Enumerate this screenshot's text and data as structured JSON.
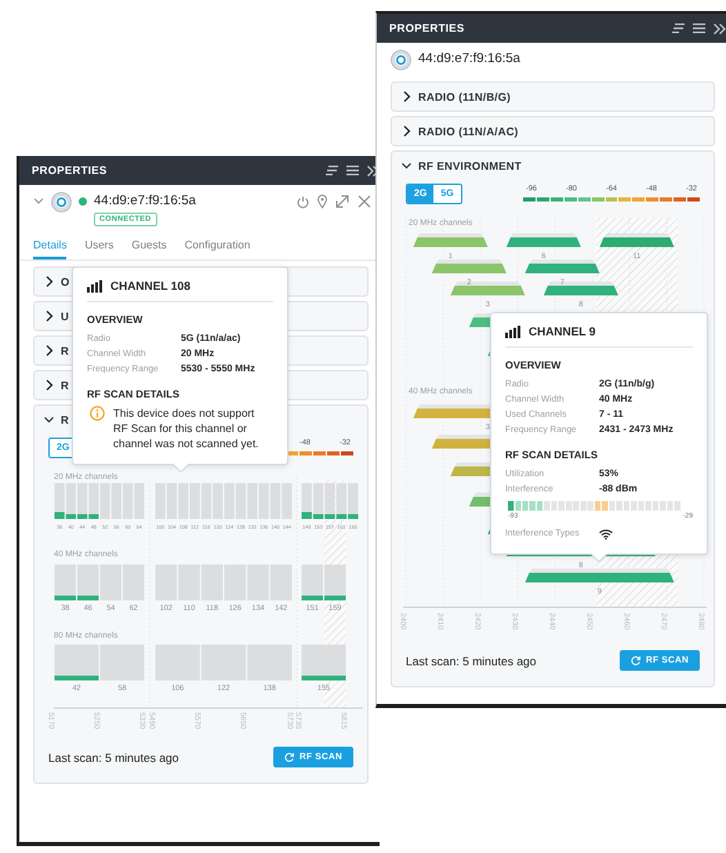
{
  "left_panel": {
    "header": {
      "title": "PROPERTIES"
    },
    "device": {
      "expanded": true,
      "online": true,
      "mac": "44:d9:e7:f9:16:5a",
      "status": "CONNECTED"
    },
    "tabs": [
      {
        "label": "Details",
        "selected": true
      },
      {
        "label": "Users",
        "selected": false
      },
      {
        "label": "Guests",
        "selected": false
      },
      {
        "label": "Configuration",
        "selected": false
      }
    ],
    "sections": [
      {
        "label": "O",
        "expanded": false
      },
      {
        "label": "U",
        "expanded": false
      },
      {
        "label": "R",
        "expanded": false
      },
      {
        "label": "R",
        "expanded": false
      },
      {
        "label": "R",
        "expanded": true
      }
    ],
    "rf": {
      "bands": [
        {
          "label": "2G",
          "selected": false
        }
      ],
      "scale": [
        "-48",
        "-32"
      ],
      "chart": {
        "kind": "grid",
        "rows": [
          {
            "label": "20 MHz channels",
            "groups": [
              [
                {
                  "label": "36",
                  "active": true
                },
                {
                  "label": "40",
                  "active": true
                },
                {
                  "label": "44",
                  "active": true
                },
                {
                  "label": "48",
                  "active": true
                },
                {
                  "label": "52",
                  "active": false
                },
                {
                  "label": "56",
                  "active": false
                },
                {
                  "label": "60",
                  "active": false
                },
                {
                  "label": "64",
                  "active": false
                }
              ],
              [
                {
                  "label": "100",
                  "active": false
                },
                {
                  "label": "104",
                  "active": false
                },
                {
                  "label": "108",
                  "active": false
                },
                {
                  "label": "112",
                  "active": false
                },
                {
                  "label": "116",
                  "active": false
                },
                {
                  "label": "120",
                  "active": false
                },
                {
                  "label": "124",
                  "active": false
                },
                {
                  "label": "128",
                  "active": false
                },
                {
                  "label": "132",
                  "active": false
                },
                {
                  "label": "136",
                  "active": false
                },
                {
                  "label": "140",
                  "active": false
                },
                {
                  "label": "144",
                  "active": false
                }
              ],
              [
                {
                  "label": "149",
                  "active": true
                },
                {
                  "label": "153",
                  "active": true
                },
                {
                  "label": "157",
                  "active": true
                },
                {
                  "label": "161",
                  "active": true
                },
                {
                  "label": "165",
                  "active": true
                }
              ]
            ]
          },
          {
            "label": "40 MHz channels",
            "groups": [
              [
                {
                  "label": "38",
                  "active": true
                },
                {
                  "label": "46",
                  "active": true
                },
                {
                  "label": "54",
                  "active": false
                },
                {
                  "label": "62",
                  "active": false
                }
              ],
              [
                {
                  "label": "102",
                  "active": false
                },
                {
                  "label": "110",
                  "active": false
                },
                {
                  "label": "118",
                  "active": false
                },
                {
                  "label": "126",
                  "active": false
                },
                {
                  "label": "134",
                  "active": false
                },
                {
                  "label": "142",
                  "active": false
                }
              ],
              [
                {
                  "label": "151",
                  "active": true
                },
                {
                  "label": "159",
                  "active": true
                }
              ]
            ]
          },
          {
            "label": "80 MHz channels",
            "groups": [
              [
                {
                  "label": "42",
                  "active": true
                },
                {
                  "label": "58",
                  "active": false
                }
              ],
              [
                {
                  "label": "106",
                  "active": false
                },
                {
                  "label": "122",
                  "active": false
                },
                {
                  "label": "138",
                  "active": false
                }
              ],
              [
                {
                  "label": "155",
                  "active": true
                }
              ]
            ]
          }
        ],
        "freq_labels": [
          "5170",
          "5250",
          "5330",
          "5490",
          "5570",
          "5650",
          "5730",
          "5735",
          "5815"
        ]
      },
      "last_scan": "Last scan: 5 minutes ago",
      "scan_button": "RF SCAN"
    },
    "tooltip": {
      "title": "CHANNEL 108",
      "blocks": [
        {
          "title": "OVERVIEW",
          "items": [
            {
              "kind": "row",
              "label": "Radio",
              "value": "5G (11n/a/ac)"
            },
            {
              "kind": "row",
              "label": "Channel Width",
              "value": "20 MHz"
            },
            {
              "kind": "row",
              "label": "Frequency Range",
              "value": "5530 - 5550 MHz"
            }
          ]
        },
        {
          "title": "RF SCAN DETAILS",
          "items": [
            {
              "kind": "notice",
              "text": "This device does not support RF Scan for this channel or channel was not scanned yet."
            }
          ]
        }
      ]
    }
  },
  "right_panel": {
    "header": {
      "title": "PROPERTIES"
    },
    "device": {
      "mac": "44:d9:e7:f9:16:5a"
    },
    "sections": [
      {
        "label": "RADIO (11N/B/G)",
        "expanded": false
      },
      {
        "label": "RADIO (11N/A/AC)",
        "expanded": false
      },
      {
        "label": "RF ENVIRONMENT",
        "expanded": true
      }
    ],
    "rf": {
      "bands": [
        {
          "label": "2G",
          "selected": true
        },
        {
          "label": "5G",
          "selected": false
        }
      ],
      "scale": [
        "-96",
        "-80",
        "-64",
        "-48",
        "-32"
      ],
      "chart": {
        "kind": "spectrum",
        "rows": [
          {
            "label": "20 MHz channels",
            "channel_labels": [
              "1",
              "6",
              "11",
              "2",
              "7",
              "3",
              "8"
            ]
          },
          {
            "label": "40 MHz channels",
            "channel_labels": [
              "3",
              "8",
              "9"
            ]
          }
        ],
        "freq_labels": [
          "2400",
          "2410",
          "2420",
          "2430",
          "2440",
          "2450",
          "2460",
          "2470",
          "2480"
        ]
      },
      "last_scan": "Last scan: 5 minutes ago",
      "scan_button": "RF SCAN"
    },
    "tooltip": {
      "title": "CHANNEL 9",
      "blocks": [
        {
          "title": "OVERVIEW",
          "items": [
            {
              "kind": "row",
              "label": "Radio",
              "value": "2G (11n/b/g)"
            },
            {
              "kind": "row",
              "label": "Channel Width",
              "value": "40 MHz"
            },
            {
              "kind": "row",
              "label": "Used Channels",
              "value": "7 - 11"
            },
            {
              "kind": "row",
              "label": "Frequency Range",
              "value": "2431 - 2473 MHz"
            }
          ]
        },
        {
          "title": "RF SCAN DETAILS",
          "items": [
            {
              "kind": "row",
              "label": "Utilization",
              "value": "53%"
            },
            {
              "kind": "row",
              "label": "Interference",
              "value": "-88 dBm"
            },
            {
              "kind": "meter",
              "level": 0.2,
              "min": "-93",
              "max": "-29"
            },
            {
              "kind": "wifi",
              "label": "Interference Types"
            }
          ]
        }
      ]
    }
  }
}
